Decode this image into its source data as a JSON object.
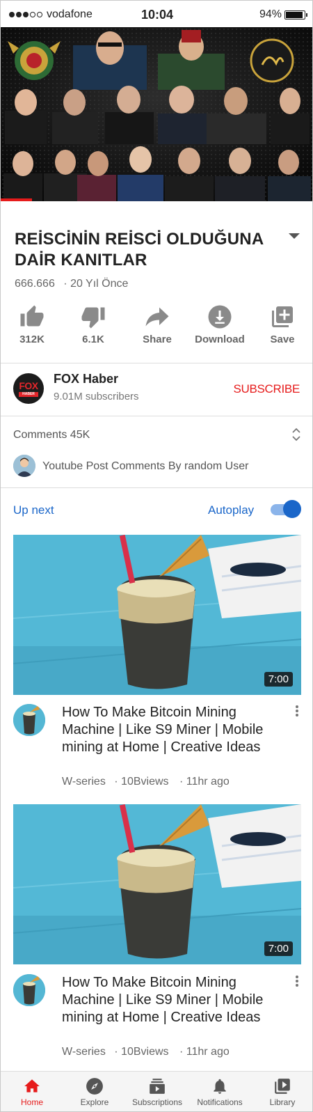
{
  "status_bar": {
    "carrier": "vodafone",
    "time": "10:04",
    "battery": "94%",
    "battery_level": 0.94
  },
  "video": {
    "progress": 0.1
  },
  "video_info": {
    "title": "REİSCİNİN REİSCİ OLDUĞUNA DAİR KANITLAR",
    "views": "666.666",
    "age": "· 20 Yıl Önce"
  },
  "actions": [
    {
      "label": "312K",
      "icon": "thumbs-up-icon"
    },
    {
      "label": "6.1K",
      "icon": "thumbs-down-icon"
    },
    {
      "label": "Share",
      "icon": "share-icon"
    },
    {
      "label": "Download",
      "icon": "download-icon"
    },
    {
      "label": "Save",
      "icon": "add-to-playlist-icon"
    }
  ],
  "channel": {
    "name": "FOX Haber",
    "subscribers": "9.01M subscribers",
    "subscribe_label": "SUBSCRIBE",
    "logo_text_1": "FOX",
    "logo_text_2": "HABER"
  },
  "comments": {
    "header": "Comments 45K",
    "preview": "Youtube Post Comments By random User"
  },
  "up_next": {
    "label": "Up next",
    "autoplay_label": "Autoplay",
    "autoplay_on": true
  },
  "cards": [
    {
      "duration": "7:00",
      "title": "How To Make Bitcoin Mining Machine | Like S9 Miner | Mobile mining at Home | Creative Ideas",
      "channel": "W-series",
      "views": "· 10Bviews",
      "age": "· 11hr ago"
    },
    {
      "duration": "7:00",
      "title": "How To Make Bitcoin Mining Machine | Like S9 Miner | Mobile mining at Home | Creative Ideas",
      "channel": "W-series",
      "views": "· 10Bviews",
      "age": "· 11hr ago"
    }
  ],
  "bottom_nav": [
    {
      "label": "Home",
      "icon": "home-icon",
      "active": true
    },
    {
      "label": "Explore",
      "icon": "explore-icon"
    },
    {
      "label": "Subscriptions",
      "icon": "subscriptions-icon"
    },
    {
      "label": "Notifications",
      "icon": "bell-icon"
    },
    {
      "label": "Library",
      "icon": "library-icon"
    }
  ],
  "colors": {
    "accent_red": "#e61b1b",
    "link_blue": "#1a66c9",
    "icon_gray": "#8a8a8a"
  }
}
